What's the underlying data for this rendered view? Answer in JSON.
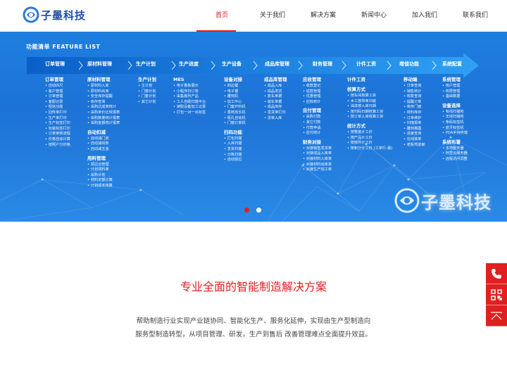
{
  "header": {
    "logo_text": "子墨科技",
    "nav": [
      "首页",
      "关于我们",
      "解决方案",
      "新闻中心",
      "加入我们",
      "联系我们"
    ],
    "active_index": 0
  },
  "banner": {
    "feature_title": "功能清单 FEATURE LIST",
    "steps": [
      "订单管理",
      "原材料管理",
      "生产计划",
      "生产进度",
      "生产设备",
      "成品库管理",
      "财务管理",
      "计件工资",
      "增值功能",
      "系统配置"
    ],
    "columns": [
      {
        "groups": [
          {
            "title": "订单管理",
            "items": [
              "自动匹尺",
              "客户管理",
              "订单管理",
              "客服记录",
              "短信功能",
              "回传单打印",
              "生产单打印",
              "生产标签打印",
              "包装标签打印",
              "订单审核流程",
              "价格自动计算",
              "按照户分价格"
            ]
          }
        ]
      },
      {
        "groups": [
          {
            "title": "原材料管理",
            "items": [
              "原材料入库",
              "原材料出库",
              "安全库存提醒",
              "库存查询",
              "采购达成率统计",
              "采购单价比较报表",
              "采购数量统计报表",
              "采购金额统计报表"
            ]
          },
          {
            "title": "自动扣减",
            "items": [
              "自动减门皮",
              "自动减线条",
              "自动减五金"
            ]
          },
          {
            "title": "用料管理",
            "items": [
              "领边合管理",
              "计划领料单",
              "采购计划",
              "材料定额计算",
              "计划成本核算"
            ]
          }
        ]
      },
      {
        "groups": [
          {
            "title": "生产计划",
            "items": [
              "主计划",
              "门窗计划",
              "门套计划",
              "其它计划"
            ]
          }
        ]
      },
      {
        "groups": [
          {
            "title": "MES",
            "items": [
              "电子看板展示",
              "小程序扫订单",
              "采集晨列产品",
              "工人自助扫描平台",
              "读取设备加工记录",
              "打包一对一出标签"
            ]
          }
        ]
      },
      {
        "groups": [
          {
            "title": "设备对接",
            "items": [
              "四边锯",
              "电子锯",
              "雕刻机",
              "加工中心",
              "门套开料机",
              "香档攻长机",
              "极孔自动机",
              "门窗订单机"
            ]
          },
          {
            "title": "扫码功能",
            "items": [
              "打包扫描",
              "入库扫描",
              "发货扫描",
              "分拣扫描",
              "自动损位"
            ]
          }
        ]
      },
      {
        "groups": [
          {
            "title": "成品库管理",
            "items": [
              "成品入库",
              "成品发货",
              "复车单据",
              "装车单据",
              "成品库存",
              "发货单打印",
              "货单入库"
            ]
          }
        ]
      },
      {
        "groups": [
          {
            "title": "应收管理",
            "items": [
              "收款登记",
              "返款管理",
              "优惠管理",
              "应收统计"
            ]
          },
          {
            "title": "应付管理",
            "items": [
              "采购付款",
              "其它付款",
              "付款申请",
              "应付统计"
            ]
          },
          {
            "title": "财务对接",
            "items": [
              "对接销售发货单",
              "对接成品入库单",
              "对接材料入库单",
              "对接材料出库单",
              "对接生产加工单"
            ]
          }
        ]
      },
      {
        "groups": [
          {
            "title": "计件工资",
            "items": []
          },
          {
            "title": "核算方式",
            "items": [
              "按车间核算工资",
              "木工按排单归底",
              "油漆按入库日期",
              "按扫码日期核算工资",
              "按订单入库核算工资"
            ]
          },
          {
            "title": "统计方式",
            "items": [
              "按整套计工价",
              "按产品计工价",
              "按部件计工价",
              "按积分计工价 (工单行-最)"
            ]
          }
        ]
      },
      {
        "groups": [
          {
            "title": "移动端",
            "items": [
              "订单查询",
              "销售统计",
              "收款查询",
              "提醒订单",
              "库存门窗",
              "材料库存",
              "订单维护",
              "扫描报单",
              "雕刻看图",
              "进度查询",
              "在线接单",
              "老板驾驶舱"
            ]
          }
        ]
      },
      {
        "groups": [
          {
            "title": "系统管理",
            "items": [
              "用户管理",
              "权限管理",
              "基础数据"
            ]
          },
          {
            "title": "设备选择",
            "items": [
              "有线扫描枪",
              "无线扫描枪",
              "条码标签机",
              "蓝牙标签机",
              "PDA手持终端"
            ]
          },
          {
            "title": "系统布署",
            "items": [
              "本地服务器",
              "阿里云服务器",
              "远程访问调整"
            ]
          }
        ]
      }
    ],
    "brand_text": "子墨科技",
    "slides": 2,
    "active_slide": 0
  },
  "content": {
    "title": "专业全面的智能制造解决方案",
    "description": "帮助制造行业实现产业链协同、智能化生产、服务化延伸，实现由生产型制造向服务型制造转型，从项目管理、研发，生产到售后 改善管理难点全面提升效益。"
  },
  "side_buttons": [
    "phone-icon",
    "qrcode-icon",
    "back-to-top-icon"
  ],
  "colors": {
    "accent": "#e02020",
    "banner": "#1d72d6",
    "logo": "#1f4fa6"
  }
}
